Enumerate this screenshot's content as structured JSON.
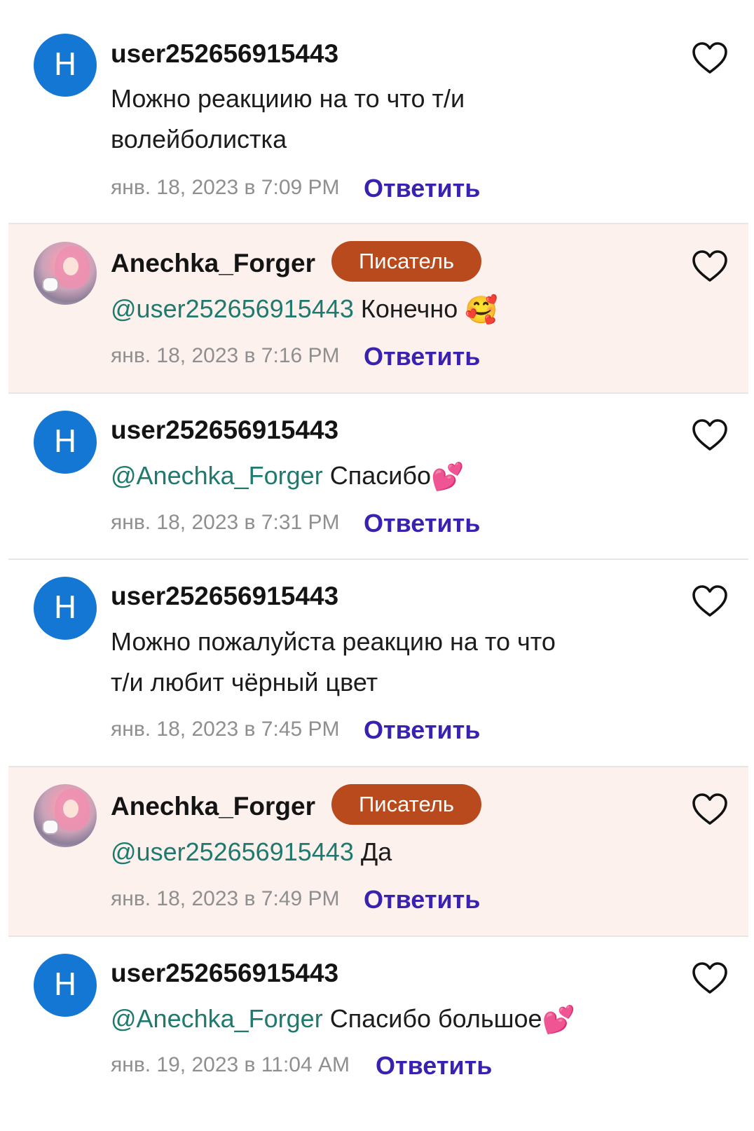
{
  "reply_label": "Ответить",
  "author_badge": "Писатель",
  "colors": {
    "author_bg": "#fdf1ee",
    "badge": "#b84a1e",
    "mention": "#1f7a6e",
    "reply": "#3a22b0",
    "avatar_letter_bg": "#1577d4"
  },
  "comments": [
    {
      "username": "user252656915443",
      "avatar_letter": "H",
      "mention": "",
      "text_line1": "Можно реакциию на то что т/и",
      "text_line2": "волейболистка",
      "emoji": "",
      "timestamp": "янв. 18, 2023 в 7:09 PM"
    },
    {
      "username": "Anechka_Forger",
      "avatar_letter": "",
      "mention": "@user252656915443",
      "text_line1": "Конечно",
      "text_line2": "",
      "emoji": "🥰",
      "timestamp": "янв. 18, 2023 в 7:16 PM"
    },
    {
      "username": "user252656915443",
      "avatar_letter": "H",
      "mention": "@Anechka_Forger",
      "text_line1": "Спасибо",
      "text_line2": "",
      "emoji": "💕",
      "timestamp": "янв. 18, 2023 в 7:31 PM"
    },
    {
      "username": "user252656915443",
      "avatar_letter": "H",
      "mention": "",
      "text_line1": "Можно пожалуйста реакцию на то что",
      "text_line2": "т/и любит чёрный цвет",
      "emoji": "",
      "timestamp": "янв. 18, 2023 в 7:45 PM"
    },
    {
      "username": "Anechka_Forger",
      "avatar_letter": "",
      "mention": "@user252656915443",
      "text_line1": "Да",
      "text_line2": "",
      "emoji": "",
      "timestamp": "янв. 18, 2023 в 7:49 PM"
    },
    {
      "username": "user252656915443",
      "avatar_letter": "H",
      "mention": "@Anechka_Forger",
      "text_line1": "Спасибо большое",
      "text_line2": "",
      "emoji": "💕",
      "timestamp": "янв. 19, 2023 в 11:04 AM"
    }
  ]
}
